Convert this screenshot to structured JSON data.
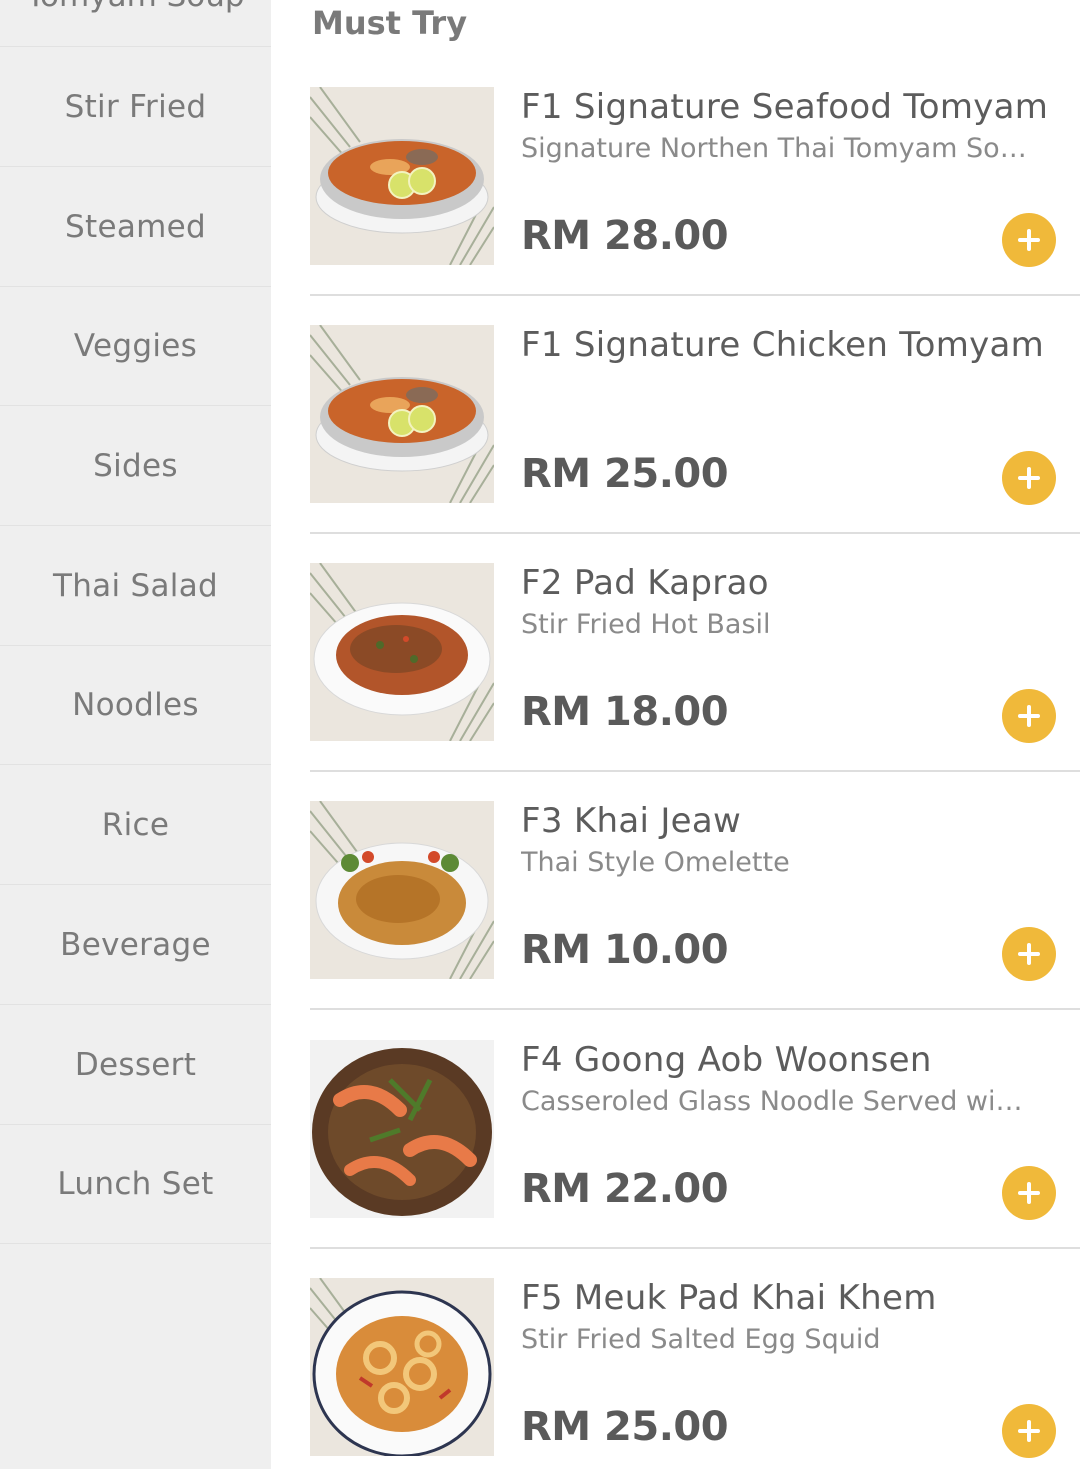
{
  "sidebar": {
    "partial_item": "Tomyam Soup",
    "items": [
      {
        "label": "Stir Fried"
      },
      {
        "label": "Steamed"
      },
      {
        "label": "Veggies"
      },
      {
        "label": "Sides"
      },
      {
        "label": "Thai Salad"
      },
      {
        "label": "Noodles"
      },
      {
        "label": "Rice"
      },
      {
        "label": "Beverage"
      },
      {
        "label": "Dessert"
      },
      {
        "label": "Lunch Set"
      }
    ]
  },
  "main": {
    "section_title": "Must Try",
    "items": [
      {
        "name": "F1 Signature Seafood Tomyam",
        "desc": "Signature Northen Thai Tomyam Soup",
        "price": "RM 28.00",
        "image": "tomyam-soup"
      },
      {
        "name": "F1 Signature Chicken Tomyam",
        "desc": "",
        "price": "RM 25.00",
        "image": "tomyam-soup"
      },
      {
        "name": "F2 Pad Kaprao",
        "desc": "Stir Fried Hot Basil",
        "price": "RM 18.00",
        "image": "basil-stir-fry"
      },
      {
        "name": "F3 Khai Jeaw",
        "desc": "Thai Style Omelette",
        "price": "RM 10.00",
        "image": "omelette"
      },
      {
        "name": "F4 Goong Aob Woonsen",
        "desc": "Casseroled Glass Noodle Served wit...",
        "price": "RM 22.00",
        "image": "prawn-glass-noodle"
      },
      {
        "name": "F5 Meuk Pad Khai Khem",
        "desc": "Stir Fried Salted Egg Squid",
        "price": "RM 25.00",
        "image": "salted-egg-squid"
      }
    ],
    "add_button_icon": "plus-icon"
  },
  "colors": {
    "accent": "#f0b93a",
    "sidebar_bg": "#efefef",
    "text": "#5c5c5c"
  }
}
